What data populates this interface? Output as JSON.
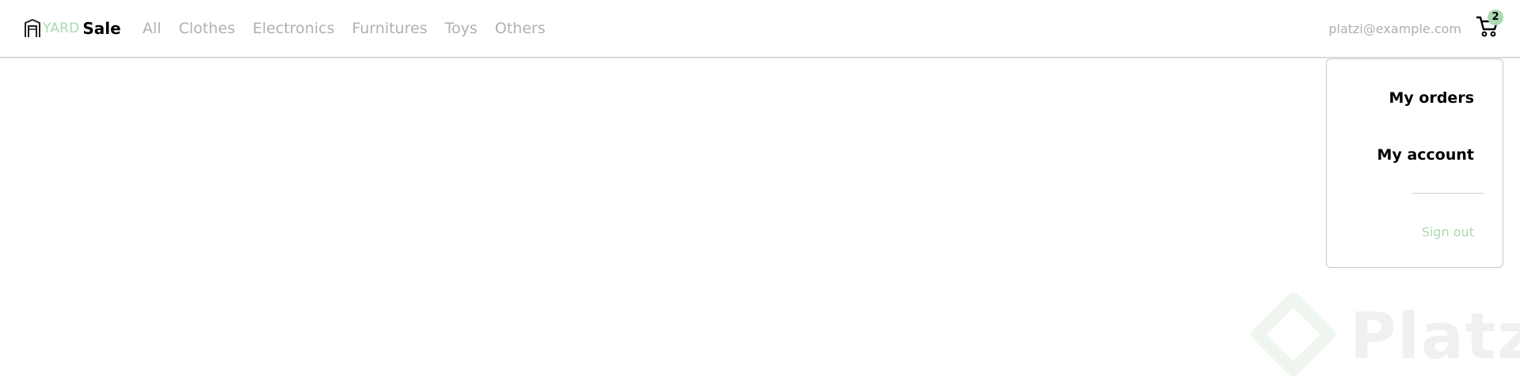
{
  "brand": {
    "yard": "YARD",
    "sale": "Sale",
    "accent_color": "#ACD9B2"
  },
  "nav": {
    "links": [
      "All",
      "Clothes",
      "Electronics",
      "Furnitures",
      "Toys",
      "Others"
    ],
    "email": "platzi@example.com"
  },
  "cart": {
    "icon": "shopping-cart-icon",
    "count": "2"
  },
  "menu": {
    "my_orders": "My orders",
    "my_account": "My account",
    "sign_out": "Sign out"
  },
  "watermark": {
    "text": "Platzi"
  }
}
